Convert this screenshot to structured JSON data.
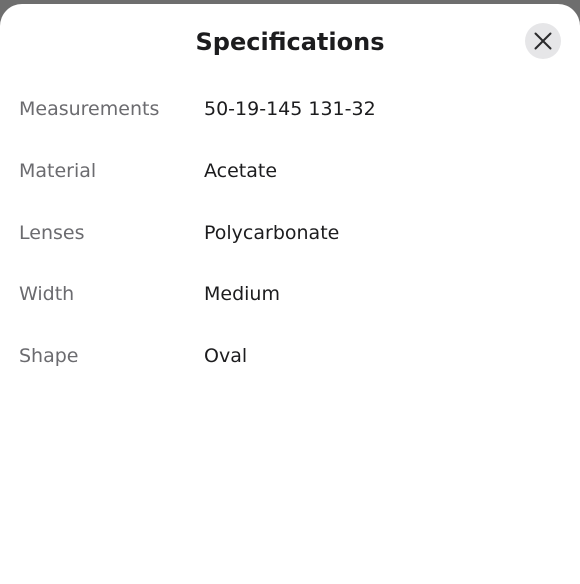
{
  "sheet": {
    "title": "Specifications",
    "close_icon": "close-icon"
  },
  "specs": [
    {
      "label": "Measurements",
      "value": "50-19-145 131-32"
    },
    {
      "label": "Material",
      "value": "Acetate"
    },
    {
      "label": "Lenses",
      "value": "Polycarbonate"
    },
    {
      "label": "Width",
      "value": "Medium"
    },
    {
      "label": "Shape",
      "value": "Oval"
    }
  ]
}
